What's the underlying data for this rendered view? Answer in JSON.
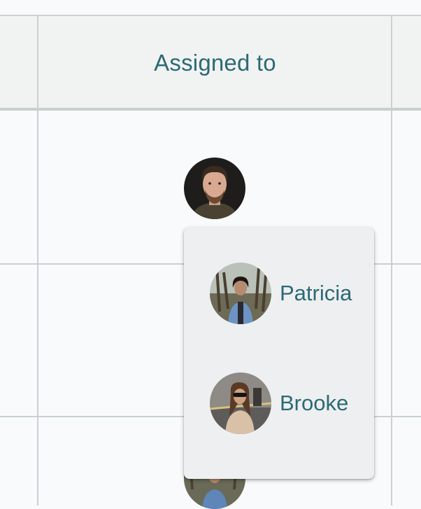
{
  "table": {
    "column_header": "Assigned to"
  },
  "rows": [
    {
      "assignee_avatar": "person-avatar"
    },
    {
      "assignee_avatar": ""
    },
    {
      "assignee_avatar": "person-avatar"
    }
  ],
  "dropdown": {
    "options": [
      {
        "label": "Patricia",
        "avatar": "person-avatar"
      },
      {
        "label": "Brooke",
        "avatar": "person-avatar"
      }
    ]
  },
  "colors": {
    "accent_text": "#2b6a74",
    "header_bg": "#f1f3f2",
    "grid_line": "#c9d1d1",
    "dropdown_bg": "#eeeff1"
  }
}
